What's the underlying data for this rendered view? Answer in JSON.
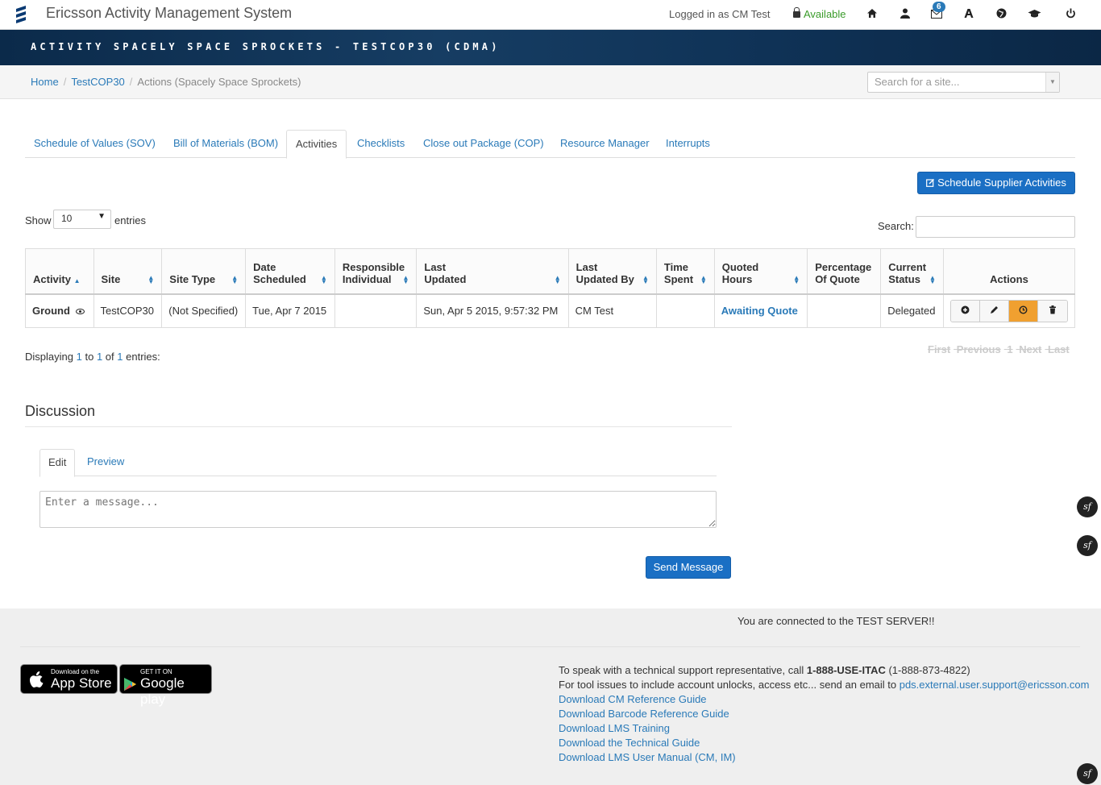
{
  "app": {
    "title": "Ericsson Activity Management System",
    "logged_in": "Logged in as CM Test",
    "status": "Available",
    "notifications": "6"
  },
  "banner": "ACTIVITY SPACELY SPACE SPROCKETS - TESTCOP30 (CDMA)",
  "breadcrumb": {
    "home": "Home",
    "site": "TestCOP30",
    "current": "Actions (Spacely Space Sprockets)"
  },
  "site_search": {
    "placeholder": "Search for a site..."
  },
  "tabs": [
    "Schedule of Values (SOV)",
    "Bill of Materials (BOM)",
    "Activities",
    "Checklists",
    "Close out Package (COP)",
    "Resource Manager",
    "Interrupts"
  ],
  "active_tab": "Activities",
  "schedule_button": "Schedule Supplier Activities",
  "table_controls": {
    "show": "Show",
    "page_size": "10",
    "entries": "entries",
    "search_label": "Search:"
  },
  "table": {
    "columns": [
      "Activity",
      "Site",
      "Site Type",
      "Date Scheduled",
      "Responsible Individual",
      "Last Updated",
      "Last Updated By",
      "Time Spent",
      "Quoted Hours",
      "Percentage Of Quote",
      "Current Status",
      "Actions"
    ],
    "rows": [
      {
        "activity": "Ground",
        "site": "TestCOP30",
        "site_type": "(Not Specified)",
        "date_scheduled": "Tue, Apr 7 2015",
        "responsible": "",
        "last_updated": "Sun, Apr 5 2015, 9:57:32 PM",
        "last_updated_by": "CM Test",
        "time_spent": "",
        "quoted_hours": "Awaiting Quote",
        "percentage": "",
        "status": "Delegated"
      }
    ]
  },
  "pagination": {
    "display_prefix": "Displaying",
    "from": "1",
    "to_word": "to",
    "to": "1",
    "of_word": "of",
    "total": "1",
    "suffix": "entries:",
    "first": "First",
    "previous": "Previous",
    "page": "1",
    "next": "Next",
    "last": "Last"
  },
  "discussion": {
    "title": "Discussion",
    "edit_tab": "Edit",
    "preview_tab": "Preview",
    "placeholder": "Enter a message...",
    "send": "Send Message"
  },
  "footer": {
    "test_server": "You are connected to the TEST SERVER!!",
    "appstore_small": "Download on the",
    "appstore_big": "App Store",
    "gplay_small": "GET IT ON",
    "gplay_big": "Google play",
    "support_prefix": "To speak with a technical support representative, call ",
    "support_phone": "1-888-USE-ITAC",
    "support_phone_alt": " (1-888-873-4822)",
    "tool_issues": "For tool issues to include account unlocks, access etc... send an email to ",
    "support_email": "pds.external.user.support@ericsson.com",
    "links": [
      "Download CM Reference Guide",
      "Download Barcode Reference Guide",
      "Download LMS Training",
      "Download the Technical Guide",
      "Download LMS User Manual (CM, IM)"
    ]
  },
  "colors": {
    "link": "#2a7ab8",
    "primary_button": "#1a6fc4",
    "banner": "#0f3256",
    "available": "#3a9b2a",
    "warning_action": "#f0a030"
  }
}
